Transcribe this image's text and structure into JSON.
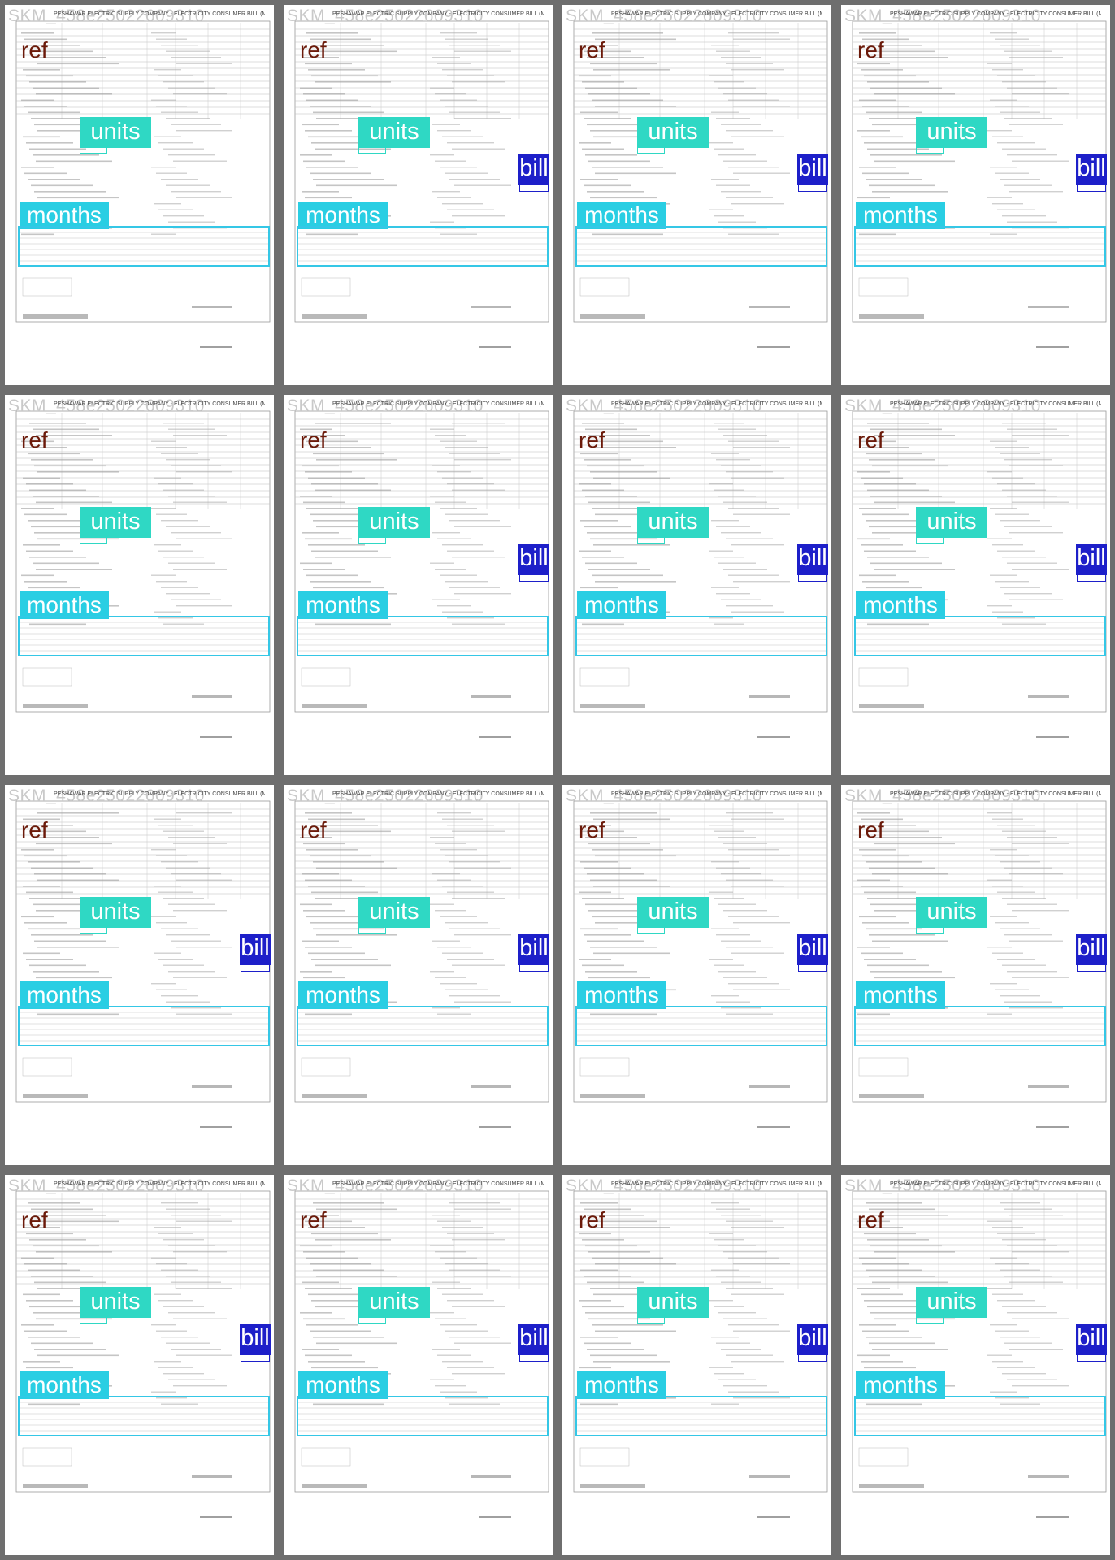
{
  "labels": {
    "ref": "ref",
    "units": "units",
    "months": "months",
    "bill": "bill"
  },
  "pages": [
    {
      "watermark": "SKM_458e25022609310",
      "header": "PESHAWAR ELECTRIC SUPPLY COMPANY - ELECTRICITY CONSUMER BILL (MDI)",
      "has_bill": false
    },
    {
      "watermark": "SKM_458e25022609310",
      "header": "PESHAWAR ELECTRIC SUPPLY COMPANY - ELECTRICITY CONSUMER BILL (MDI)",
      "has_bill": true
    },
    {
      "watermark": "SKM_458e25022609310",
      "header": "PESHAWAR ELECTRIC SUPPLY COMPANY - ELECTRICITY CONSUMER BILL (MDI)",
      "has_bill": true
    },
    {
      "watermark": "SKM_458e25022609310",
      "header": "PESHAWAR ELECTRIC SUPPLY COMPANY - ELECTRICITY CONSUMER BILL (MDI)",
      "has_bill": true
    },
    {
      "watermark": "SKM_458e25022609310",
      "header": "PESHAWAR ELECTRIC SUPPLY COMPANY - ELECTRICITY CONSUMER BILL (MDI)",
      "has_bill": false
    },
    {
      "watermark": "SKM_458e25022609310",
      "header": "PESHAWAR ELECTRIC SUPPLY COMPANY - ELECTRICITY CONSUMER BILL (MDI)",
      "has_bill": true
    },
    {
      "watermark": "SKM_458e25022609310",
      "header": "PESHAWAR ELECTRIC SUPPLY COMPANY - ELECTRICITY CONSUMER BILL (MDI)",
      "has_bill": true
    },
    {
      "watermark": "SKM_458e25022609310",
      "header": "PESHAWAR ELECTRIC SUPPLY COMPANY - ELECTRICITY CONSUMER BILL (MDI)",
      "has_bill": true
    },
    {
      "watermark": "SKM_458e25022609310",
      "header": "PESHAWAR ELECTRIC SUPPLY COMPANY - ELECTRICITY CONSUMER BILL (MDI)",
      "has_bill": true
    },
    {
      "watermark": "SKM_458e25022609310",
      "header": "PESHAWAR ELECTRIC SUPPLY COMPANY - ELECTRICITY CONSUMER BILL (MDI)",
      "has_bill": true
    },
    {
      "watermark": "SKM_458e25022609310",
      "header": "PESHAWAR ELECTRIC SUPPLY COMPANY - ELECTRICITY CONSUMER BILL (MDI)",
      "has_bill": true
    },
    {
      "watermark": "SKM_458e25022609310",
      "header": "PESHAWAR ELECTRIC SUPPLY COMPANY - ELECTRICITY CONSUMER BILL (MDI)",
      "has_bill": true
    },
    {
      "watermark": "SKM_458e25022609310",
      "header": "PESHAWAR ELECTRIC SUPPLY COMPANY - ELECTRICITY CONSUMER BILL (MDI)",
      "has_bill": true
    },
    {
      "watermark": "SKM_458e25022609310",
      "header": "PESHAWAR ELECTRIC SUPPLY COMPANY - ELECTRICITY CONSUMER BILL (MDI)",
      "has_bill": true
    },
    {
      "watermark": "SKM_458e25022609310",
      "header": "PESHAWAR ELECTRIC SUPPLY COMPANY - ELECTRICITY CONSUMER BILL (MDI)",
      "has_bill": true
    },
    {
      "watermark": "SKM_458e25022609310",
      "header": "PESHAWAR ELECTRIC SUPPLY COMPANY - ELECTRICITY CONSUMER BILL (MDI)",
      "has_bill": true
    }
  ],
  "colors": {
    "units_tag": "#2fd8c4",
    "months_tag": "#29cee3",
    "bill_tag": "#1d1fc9",
    "ref_text": "#6b1a0a",
    "border": "#6e6e6e"
  }
}
